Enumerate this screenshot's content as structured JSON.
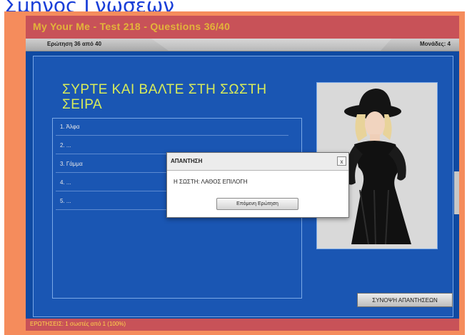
{
  "top_link": "Σμήνος Γνώσεων",
  "app": {
    "title": "My Your Me - Test 218 - Questions 36/40",
    "tab_left": "Ερώτηση 36 από 40",
    "tab_right": "Μονάδες: 4",
    "question": "ΣΥΡΤΕ ΚΑΙ ΒΑΛΤΕ ΣΤΗ ΣΩΣΤΗ ΣΕΙΡΑ",
    "answers": [
      "1. Άλφα",
      "2. ...",
      "3. Γάμμα",
      "4. ...",
      "5. ..."
    ],
    "summary_button": "ΣΥΝΟΨΗ ΑΠΑΝΤΗΣΕΩΝ",
    "status": "ΕΡΩΤΗΣΕΙΣ: 1 σωστές από 1 (100%)"
  },
  "dialog": {
    "title": "ΑΠΑΝΤΗΣΗ",
    "close": "x",
    "message": "Η ΣΩΣΤΗ: ΛΑΘΟΣ ΕΠΙΛΟΓΗ",
    "button": "Επόμενη Ερώτηση"
  },
  "colors": {
    "frame": "#f58c5c",
    "titlebar": "#c85258",
    "title_text": "#e3b43a",
    "content": "#1a56b3",
    "question_text": "#d8ec5a"
  }
}
